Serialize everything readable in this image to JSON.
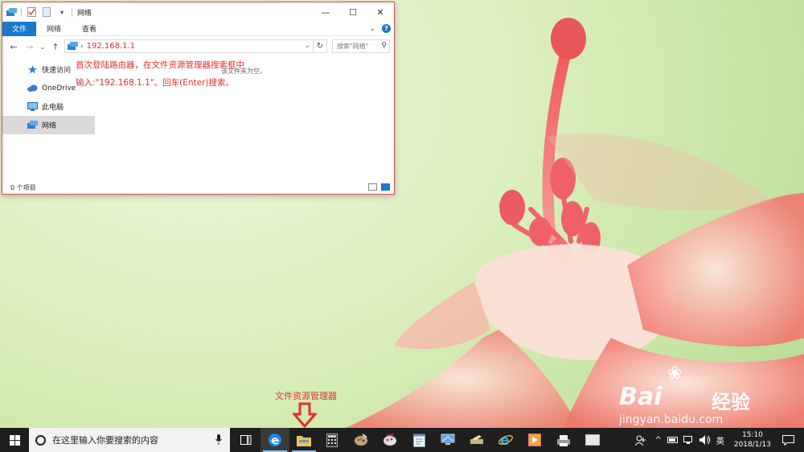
{
  "window": {
    "title": "网络",
    "quick_access_dropdown": "▾",
    "controls": {
      "minimize": "—",
      "maximize": "☐",
      "close": "✕"
    }
  },
  "ribbon": {
    "tabs": [
      "文件",
      "网络",
      "查看"
    ],
    "expand": "⌄",
    "help": "?"
  },
  "navigation": {
    "back": "←",
    "forward": "→",
    "recent": "⌄",
    "up": "↑",
    "breadcrumb_sep": "›",
    "address": "192.168.1.1",
    "address_dropdown": "⌄",
    "refresh": "↻",
    "search_placeholder": "搜索\"网络\"",
    "search_icon_glyph": "⚲"
  },
  "sidebar": {
    "items": [
      {
        "label": "快速访问",
        "icon": "star-icon"
      },
      {
        "label": "OneDrive",
        "icon": "cloud-icon"
      },
      {
        "label": "此电脑",
        "icon": "computer-icon"
      },
      {
        "label": "网络",
        "icon": "network-icon",
        "selected": true
      }
    ]
  },
  "content": {
    "empty_text": "该文件夹为空。",
    "annotation": "首次登陆路由器，在文件资源管理器搜索框中输入:\"192.168.1.1\"。回车(Enter)搜索。"
  },
  "statusbar": {
    "item_count": "0 个项目"
  },
  "taskbar": {
    "search_placeholder": "在这里输入你要搜索的内容",
    "arrow_label": "文件资源管理器",
    "tray_input": "英",
    "tray_up": "^",
    "time": "15:10",
    "date": "2018/1/13"
  },
  "watermark": {
    "brand": "Bai",
    "brand_cn": "经验",
    "url": "jingyan.baidu.com"
  },
  "colors": {
    "accent": "#1979ca",
    "annotation": "#e03030",
    "taskbar": "#1f1f1f"
  }
}
